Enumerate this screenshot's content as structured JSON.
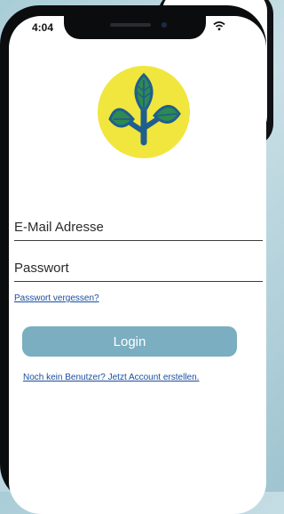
{
  "status_bar": {
    "time": "4:04"
  },
  "form": {
    "email_placeholder": "E-Mail Adresse",
    "password_placeholder": "Passwort",
    "forgot_link": "Passwort vergessen?",
    "login_button": "Login",
    "register_link": "Noch kein Benutzer? Jetzt Account erstellen."
  },
  "colors": {
    "background": "#b6d5de",
    "logo_circle": "#f1e63e",
    "logo_plant": "#2f8a4e",
    "logo_stem": "#1f5f8f",
    "button": "#7aaec0",
    "link": "#1a4d9e"
  },
  "icons": {
    "logo": "plant-sprout-icon",
    "wifi": "wifi-icon"
  }
}
